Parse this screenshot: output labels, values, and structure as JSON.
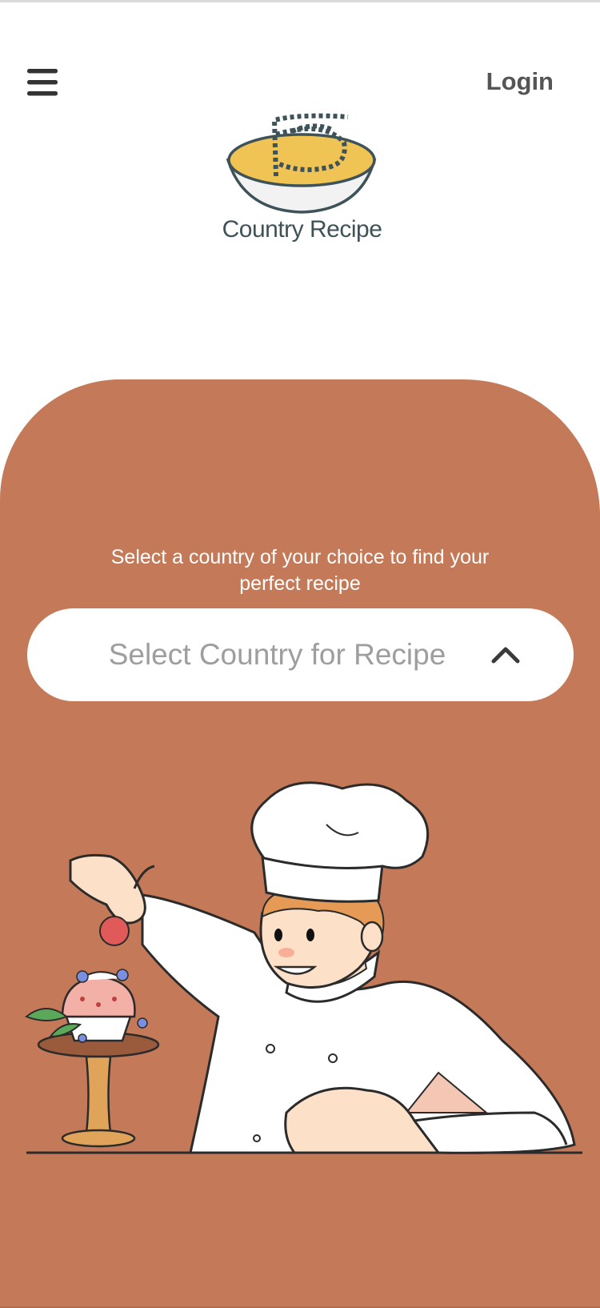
{
  "header": {
    "menu_icon": "hamburger-menu-icon",
    "login_label": "Login"
  },
  "logo": {
    "icon": "soup-bowl-logo-icon",
    "text": "Country Recipe"
  },
  "main": {
    "instruction": "Select a country of your choice to find your perfect recipe",
    "country_select": {
      "placeholder": "Select Country for Recipe",
      "icon": "chevron-up-icon"
    },
    "illustration": "chef-decorating-cupcake-illustration"
  },
  "colors": {
    "panel": "#c47a58",
    "text_dark": "#555555",
    "logo_text": "#3d5259",
    "bowl_fill": "#f0c355",
    "placeholder": "#9e9e9e"
  }
}
